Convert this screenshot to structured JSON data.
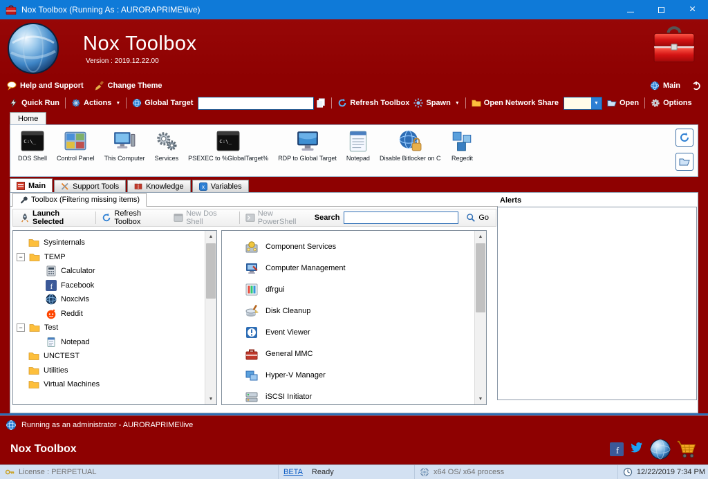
{
  "colors": {
    "titlebar_blue": "#0f7ad8",
    "app_red": "#8e0101",
    "accent_blue": "#2d7fd3",
    "folder_yellow": "#fdbf3c",
    "statusbar_bg": "#d3e1f2",
    "link_blue": "#0a5bc4"
  },
  "icons": {
    "app": "red-toolbox",
    "logo": "blue-globe-sphere",
    "help": "speech-bubble",
    "change_theme": "paint-brush",
    "quick_run": "lightning-bolt",
    "actions": "gear",
    "global_target": "globe",
    "copy": "copy-pages",
    "refresh": "blue-circular-arrow",
    "spawn": "blue-starburst",
    "open_network_share": "yellow-folder",
    "open": "open-folder",
    "options": "gear",
    "search": "magnifier",
    "power": "power-ring"
  },
  "window": {
    "title": "Nox Toolbox (Running As : AURORAPRIME\\live)"
  },
  "header": {
    "title": "Nox Toolbox",
    "version": "Version : 2019.12.22.00"
  },
  "menubar": {
    "help": "Help and Support",
    "change_theme": "Change Theme",
    "main": "Main"
  },
  "toolbar": {
    "quick_run": "Quick Run",
    "actions": "Actions",
    "global_target_label": "Global Target",
    "global_target_value": "",
    "refresh": "Refresh Toolbox",
    "spawn": "Spawn",
    "open_network_share": "Open Network Share",
    "network_share_value": "",
    "open": "Open",
    "options": "Options"
  },
  "home_tab": "Home",
  "quick_icons": [
    {
      "label": "DOS Shell",
      "icon": "terminal-icon"
    },
    {
      "label": "Control Panel",
      "icon": "control-panel-icon"
    },
    {
      "label": "This Computer",
      "icon": "computer-icon"
    },
    {
      "label": "Services",
      "icon": "gears-icon"
    },
    {
      "label": "PSEXEC to %GlobalTarget%",
      "icon": "terminal-icon"
    },
    {
      "label": "RDP to Global Target",
      "icon": "monitor-icon"
    },
    {
      "label": "Notepad",
      "icon": "notepad-icon"
    },
    {
      "label": "Disable Bitlocker on C",
      "icon": "globe-lock-icon"
    },
    {
      "label": "Regedit",
      "icon": "cubes-icon"
    }
  ],
  "tabs": [
    {
      "label": "Main",
      "icon": "red-window-icon"
    },
    {
      "label": "Support Tools",
      "icon": "wrench-icon"
    },
    {
      "label": "Knowledge",
      "icon": "book-icon"
    },
    {
      "label": "Variables",
      "icon": "variables-icon"
    }
  ],
  "toolbox_tab": "Toolbox (Filtering missing items)",
  "inner_toolbar": {
    "launch": "Launch Selected",
    "refresh": "Refresh Toolbox",
    "new_dos": "New Dos Shell",
    "new_powershell": "New PowerShell",
    "search_label": "Search",
    "search_value": "",
    "go": "Go"
  },
  "tree": {
    "items": [
      {
        "label": "Sysinternals",
        "level": 1,
        "icon": "folder-icon"
      },
      {
        "label": "TEMP",
        "level": 1,
        "icon": "folder-icon",
        "expanded": true
      },
      {
        "label": "Calculator",
        "level": 2,
        "icon": "calculator-icon"
      },
      {
        "label": "Facebook",
        "level": 2,
        "icon": "facebook-icon"
      },
      {
        "label": "Noxcivis",
        "level": 2,
        "icon": "globe-icon"
      },
      {
        "label": "Reddit",
        "level": 2,
        "icon": "reddit-icon"
      },
      {
        "label": "Test",
        "level": 1,
        "icon": "folder-icon",
        "expanded": true
      },
      {
        "label": "Notepad",
        "level": 2,
        "icon": "notepad-icon"
      },
      {
        "label": "UNCTEST",
        "level": 1,
        "icon": "folder-icon"
      },
      {
        "label": "Utilities",
        "level": 1,
        "icon": "folder-icon"
      },
      {
        "label": "Virtual Machines",
        "level": 1,
        "icon": "folder-icon"
      }
    ]
  },
  "tools": [
    {
      "label": "Component Services",
      "icon": "component-services-icon"
    },
    {
      "label": "Computer Management",
      "icon": "computer-management-icon"
    },
    {
      "label": "dfrgui",
      "icon": "defrag-icon"
    },
    {
      "label": "Disk Cleanup",
      "icon": "disk-cleanup-icon"
    },
    {
      "label": "Event Viewer",
      "icon": "event-viewer-icon"
    },
    {
      "label": "General MMC",
      "icon": "mmc-icon"
    },
    {
      "label": "Hyper-V Manager",
      "icon": "hyperv-icon"
    },
    {
      "label": "iSCSI Initiator",
      "icon": "iscsi-icon"
    }
  ],
  "alerts_title": "Alerts",
  "status_strip": {
    "text": "Running as an administrator - AURORAPRIME\\live"
  },
  "footer": {
    "title": "Nox Toolbox"
  },
  "statusbar": {
    "license": "License : PERPETUAL",
    "beta": "BETA",
    "ready": "Ready",
    "arch": "x64 OS/ x64 process",
    "datetime": "12/22/2019 7:34 PM"
  }
}
